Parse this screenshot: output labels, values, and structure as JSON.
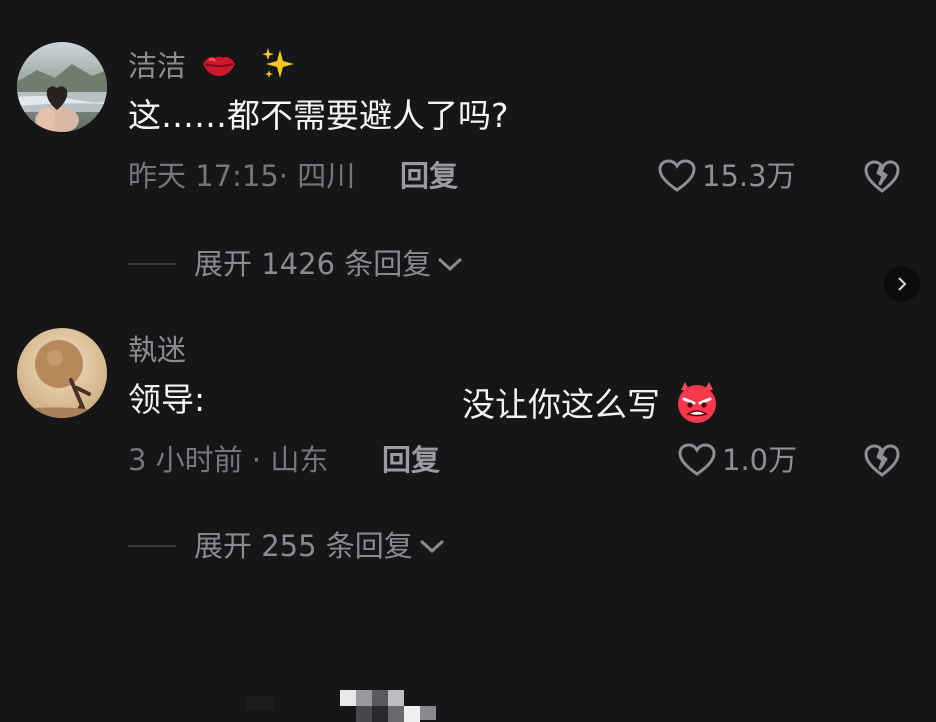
{
  "comments": [
    {
      "username": "洁洁",
      "username_emojis": [
        "lips-emoji",
        "sparkles-emoji"
      ],
      "text": "这……都不需要避人了吗?",
      "meta": "昨天 17:15· 四川",
      "reply_label": "回复",
      "like_count": "15.3万",
      "expand_label": "展开 1426 条回复"
    },
    {
      "username": "執迷",
      "text_prefix": "领导:",
      "text_suffix": "没让你这么写",
      "text_emoji": "angry-devil-emoji",
      "meta": "3 小时前 · 山东",
      "reply_label": "回复",
      "like_count": "1.0万",
      "expand_label": "展开 255 条回复"
    }
  ],
  "colors": {
    "background": "#161618",
    "username": "#8c8c90",
    "text": "#f4f4f4",
    "meta": "#75757a"
  }
}
